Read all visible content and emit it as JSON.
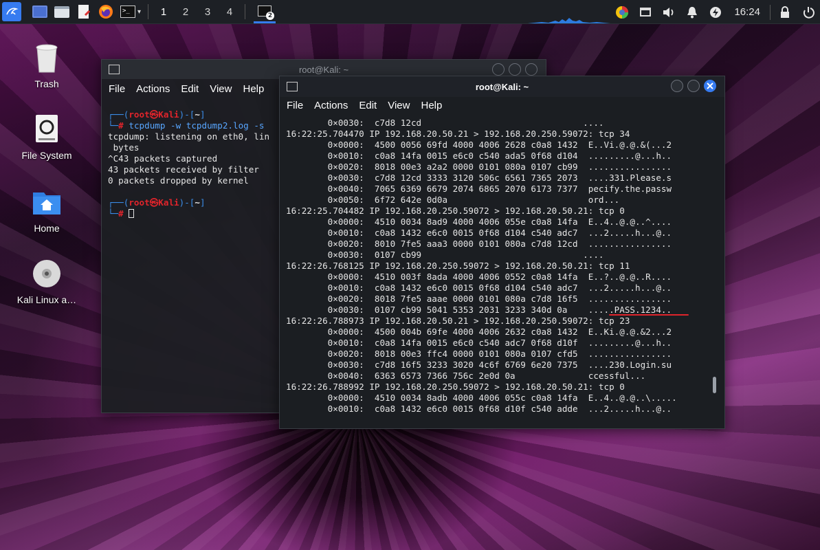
{
  "panel": {
    "workspaces": [
      "1",
      "2",
      "3",
      "4"
    ],
    "active_workspace": "1",
    "task_badge": "2",
    "clock": "16:24"
  },
  "desktop": {
    "icons": [
      {
        "label": "Trash"
      },
      {
        "label": "File System"
      },
      {
        "label": "Home"
      },
      {
        "label": "Kali Linux a…"
      }
    ]
  },
  "back_window": {
    "title": "root@Kali: ~",
    "menu": [
      "File",
      "Actions",
      "Edit",
      "View",
      "Help"
    ],
    "prompt_user": "root",
    "prompt_at": "㉿",
    "prompt_host": "Kali",
    "prompt_dir": "~",
    "command": "tcpdump -w tcpdump2.log -s",
    "output": [
      "tcpdump: listening on eth0, lin",
      " bytes",
      "^C43 packets captured",
      "43 packets received by filter",
      "0 packets dropped by kernel"
    ]
  },
  "front_window": {
    "title": "root@Kali: ~",
    "menu": [
      "File",
      "Actions",
      "Edit",
      "View",
      "Help"
    ],
    "lines": [
      "        0×0030:  c7d8 12cd                               ....",
      "16:22:25.704470 IP 192.168.20.50.21 > 192.168.20.250.59072: tcp 34",
      "        0×0000:  4500 0056 69fd 4000 4006 2628 c0a8 1432  E..Vi.@.@.&(...2",
      "        0×0010:  c0a8 14fa 0015 e6c0 c540 ada5 0f68 d104  .........@...h..",
      "        0×0020:  8018 00e3 a2a2 0000 0101 080a 0107 cb99  ................",
      "        0×0030:  c7d8 12cd 3333 3120 506c 6561 7365 2073  ....331.Please.s",
      "        0×0040:  7065 6369 6679 2074 6865 2070 6173 7377  pecify.the.passw",
      "        0×0050:  6f72 642e 0d0a                           ord...",
      "16:22:25.704482 IP 192.168.20.250.59072 > 192.168.20.50.21: tcp 0",
      "        0×0000:  4510 0034 8ad9 4000 4006 055e c0a8 14fa  E..4..@.@..^....",
      "        0×0010:  c0a8 1432 e6c0 0015 0f68 d104 c540 adc7  ...2.....h...@..",
      "        0×0020:  8010 7fe5 aaa3 0000 0101 080a c7d8 12cd  ................",
      "        0×0030:  0107 cb99                               ....",
      "16:22:26.768125 IP 192.168.20.250.59072 > 192.168.20.50.21: tcp 11",
      "        0×0000:  4510 003f 8ada 4000 4006 0552 c0a8 14fa  E..?..@.@..R....",
      "        0×0010:  c0a8 1432 e6c0 0015 0f68 d104 c540 adc7  ...2.....h...@..",
      "        0×0020:  8018 7fe5 aaae 0000 0101 080a c7d8 16f5  ................",
      "        0×0030:  0107 cb99 5041 5353 2031 3233 340d 0a    .....PASS.1234..",
      "16:22:26.788973 IP 192.168.20.50.21 > 192.168.20.250.59072: tcp 23",
      "        0×0000:  4500 004b 69fe 4000 4006 2632 c0a8 1432  E..Ki.@.@.&2...2",
      "        0×0010:  c0a8 14fa 0015 e6c0 c540 adc7 0f68 d10f  .........@...h..",
      "        0×0020:  8018 00e3 ffc4 0000 0101 080a 0107 cfd5  ................",
      "        0×0030:  c7d8 16f5 3233 3020 4c6f 6769 6e20 7375  ....230.Login.su",
      "        0×0040:  6363 6573 7366 756c 2e0d 0a              ccessful...",
      "16:22:26.788992 IP 192.168.20.250.59072 > 192.168.20.50.21: tcp 0",
      "        0×0000:  4510 0034 8adb 4000 4006 055c c0a8 14fa  E..4..@.@..\\.....",
      "        0×0010:  c0a8 1432 e6c0 0015 0f68 d10f c540 adde  ...2.....h...@.."
    ]
  },
  "colors": {
    "accent": "#367bf0",
    "terminal_bg": "#1b1e22",
    "prompt_red": "#e0242b"
  }
}
